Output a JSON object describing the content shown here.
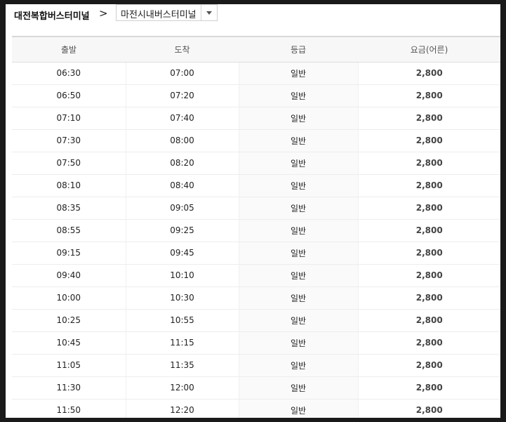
{
  "route": {
    "origin": "대전복합버스터미널",
    "arrow": ">",
    "destination": "마전시내버스터미널"
  },
  "table": {
    "headers": [
      "출발",
      "도착",
      "등급",
      "요금(어른)"
    ],
    "rows": [
      [
        "06:30",
        "07:00",
        "일반",
        "2,800"
      ],
      [
        "06:50",
        "07:20",
        "일반",
        "2,800"
      ],
      [
        "07:10",
        "07:40",
        "일반",
        "2,800"
      ],
      [
        "07:30",
        "08:00",
        "일반",
        "2,800"
      ],
      [
        "07:50",
        "08:20",
        "일반",
        "2,800"
      ],
      [
        "08:10",
        "08:40",
        "일반",
        "2,800"
      ],
      [
        "08:35",
        "09:05",
        "일반",
        "2,800"
      ],
      [
        "08:55",
        "09:25",
        "일반",
        "2,800"
      ],
      [
        "09:15",
        "09:45",
        "일반",
        "2,800"
      ],
      [
        "09:40",
        "10:10",
        "일반",
        "2,800"
      ],
      [
        "10:00",
        "10:30",
        "일반",
        "2,800"
      ],
      [
        "10:25",
        "10:55",
        "일반",
        "2,800"
      ],
      [
        "10:45",
        "11:15",
        "일반",
        "2,800"
      ],
      [
        "11:05",
        "11:35",
        "일반",
        "2,800"
      ],
      [
        "11:30",
        "12:00",
        "일반",
        "2,800"
      ],
      [
        "11:50",
        "12:20",
        "일반",
        "2,800"
      ]
    ]
  }
}
